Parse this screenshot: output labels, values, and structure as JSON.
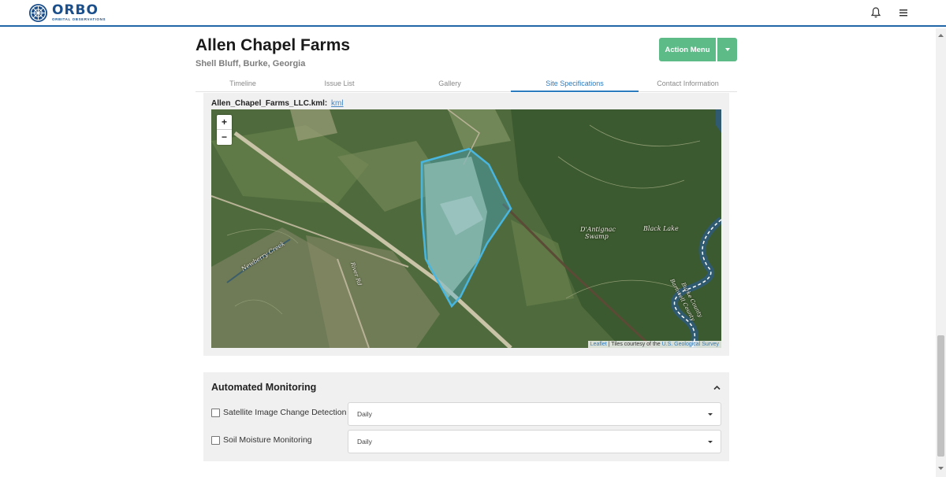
{
  "header": {
    "logo_text": "ORBO",
    "logo_subtext": "ORBITAL OBSERVATIONS",
    "icons": [
      "bell-icon",
      "hamburger-menu-icon"
    ]
  },
  "page": {
    "title": "Allen Chapel Farms",
    "subtitle": "Shell Bluff, Burke, Georgia",
    "action_menu_label": "Action Menu"
  },
  "tabs": [
    {
      "label": "Timeline",
      "active": false
    },
    {
      "label": "Issue List",
      "active": false
    },
    {
      "label": "Gallery",
      "active": false
    },
    {
      "label": "Site Specifications",
      "active": true
    },
    {
      "label": "Contact Information",
      "active": false
    }
  ],
  "site_spec": {
    "kml_filename": "Allen_Chapel_Farms_LLC.kml:",
    "kml_link": "kml"
  },
  "map": {
    "zoom_in": "+",
    "zoom_out": "−",
    "labels": {
      "swamp_line1": "D'Antignac",
      "swamp_line2": "Swamp",
      "lake": "Black Lake",
      "creek": "Newberry Creek",
      "road": "River Rd",
      "county": "Barnwell County",
      "county2": "Burke County"
    },
    "attribution": {
      "leaflet": "Leaflet",
      "mid": " | Tiles courtesy of the ",
      "source": "U.S. Geological Survey"
    },
    "polygon_color": "#49b6e0"
  },
  "monitoring": {
    "title": "Automated Monitoring",
    "rows": [
      {
        "label": "Satellite Image Change Detection",
        "frequency": "Daily",
        "checked": false
      },
      {
        "label": "Soil Moisture Monitoring",
        "frequency": "Daily",
        "checked": false
      }
    ]
  },
  "colors": {
    "accent_blue": "#2166a6",
    "action_green": "#5dbb88",
    "tab_active": "#2b7bbf"
  }
}
